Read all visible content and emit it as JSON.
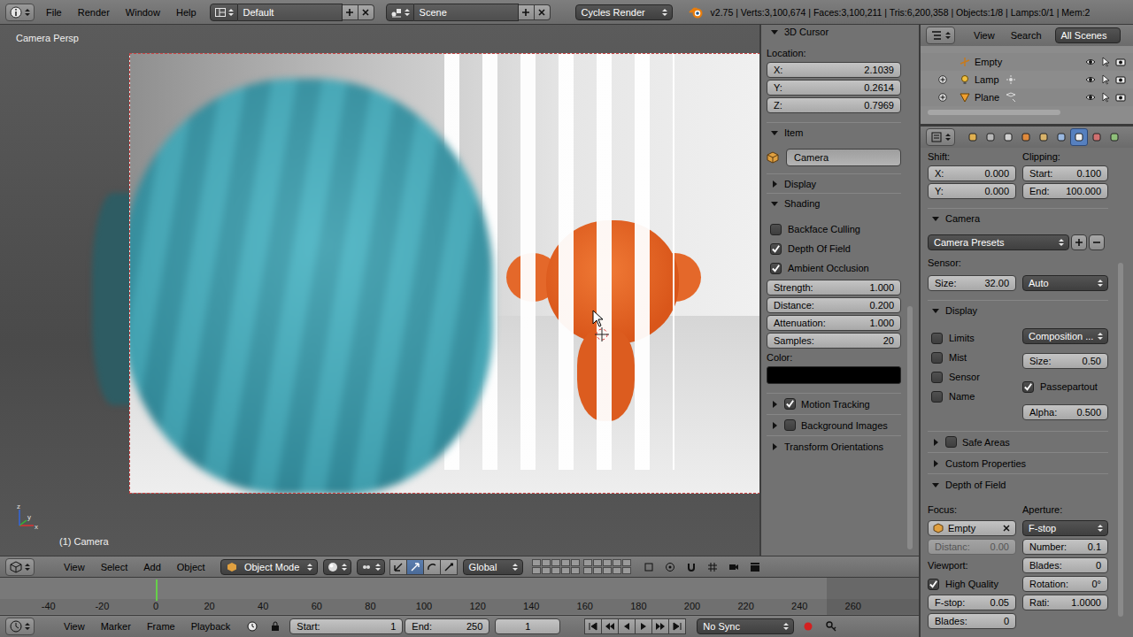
{
  "topbar": {
    "menus": [
      "File",
      "Render",
      "Window",
      "Help"
    ],
    "layout": "Default",
    "scene": "Scene",
    "engine": "Cycles Render",
    "stats": "v2.75 | Verts:3,100,674 | Faces:3,100,211 | Tris:6,200,358 | Objects:1/8 | Lamps:0/1 | Mem:2"
  },
  "viewport": {
    "view_name": "Camera Persp",
    "object_label": "(1) Camera",
    "axes": [
      "x",
      "y",
      "z"
    ]
  },
  "n_panel": {
    "cursor": {
      "title": "3D Cursor",
      "expanded": true,
      "location_label": "Location:",
      "fields": [
        {
          "label": "X:",
          "value": "2.1039"
        },
        {
          "label": "Y:",
          "value": "0.2614"
        },
        {
          "label": "Z:",
          "value": "0.7969"
        }
      ]
    },
    "item": {
      "title": "Item",
      "expanded": true,
      "name": "Camera"
    },
    "display": {
      "title": "Display",
      "expanded": false
    },
    "shading": {
      "title": "Shading",
      "expanded": true,
      "toggles": [
        {
          "label": "Backface Culling",
          "checked": false
        },
        {
          "label": "Depth Of Field",
          "checked": true
        },
        {
          "label": "Ambient Occlusion",
          "checked": true
        }
      ],
      "fields": [
        {
          "label": "Strength:",
          "value": "1.000"
        },
        {
          "label": "Distance:",
          "value": "0.200"
        },
        {
          "label": "Attenuation:",
          "value": "1.000"
        },
        {
          "label": "Samples:",
          "value": "20"
        }
      ],
      "color_label": "Color:",
      "color": "#000000"
    },
    "more_panels": [
      {
        "title": "Motion Tracking",
        "kind": "toggle",
        "checked": true,
        "expanded": false
      },
      {
        "title": "Background Images",
        "kind": "toggle",
        "checked": false,
        "expanded": false
      },
      {
        "title": "Transform Orientations",
        "kind": "plain",
        "checked": false,
        "expanded": false
      }
    ]
  },
  "outliner": {
    "menus": [
      "View",
      "Search"
    ],
    "filter": "All Scenes",
    "rows": [
      {
        "name": "Empty",
        "kind": "empty",
        "expandable": false
      },
      {
        "name": "Lamp",
        "kind": "lamp",
        "expandable": true
      },
      {
        "name": "Plane",
        "kind": "mesh",
        "expandable": true
      }
    ]
  },
  "properties": {
    "tabs": [
      {
        "selected": false
      },
      {
        "selected": false
      },
      {
        "selected": false
      },
      {
        "selected": false
      },
      {
        "selected": false
      },
      {
        "selected": false
      },
      {
        "selected": true
      },
      {
        "selected": false
      },
      {
        "selected": false
      }
    ],
    "lens": {
      "shift_label": "Shift:",
      "shift": [
        {
          "label": "X:",
          "value": "0.000"
        },
        {
          "label": "Y:",
          "value": "0.000"
        }
      ],
      "clipping_label": "Clipping:",
      "clipping": [
        {
          "label": "Start:",
          "value": "0.100"
        },
        {
          "label": "End:",
          "value": "100.000"
        }
      ]
    },
    "camera": {
      "title": "Camera",
      "expanded": true,
      "presets": "Camera Presets",
      "sensor_label": "Sensor:",
      "size": {
        "label": "Size:",
        "value": "32.00"
      },
      "fit": "Auto"
    },
    "display": {
      "title": "Display",
      "expanded": true,
      "toggles": [
        {
          "label": "Limits",
          "checked": false
        },
        {
          "label": "Mist",
          "checked": false
        },
        {
          "label": "Sensor",
          "checked": false
        },
        {
          "label": "Name",
          "checked": false
        }
      ],
      "composition": "Composition ...",
      "size": {
        "label": "Size:",
        "value": "0.50"
      },
      "passepartout": {
        "label": "Passepartout",
        "checked": true
      },
      "alpha": {
        "label": "Alpha:",
        "value": "0.500"
      }
    },
    "more_panels": [
      {
        "title": "Safe Areas",
        "kind": "toggle",
        "checked": false,
        "expanded": false
      },
      {
        "title": "Custom Properties",
        "kind": "plain",
        "checked": false,
        "expanded": false
      }
    ],
    "dof": {
      "title": "Depth of Field",
      "expanded": true,
      "focus_label": "Focus:",
      "focus_object": "Empty",
      "distance": {
        "label": "Distanc:",
        "value": "0.00",
        "disabled": true
      },
      "viewport_label": "Viewport:",
      "high_quality": {
        "label": "High Quality",
        "checked": true
      },
      "viewport_fields": [
        {
          "label": "F-stop:",
          "value": "0.05"
        },
        {
          "label": "Blades:",
          "value": "0"
        }
      ],
      "aperture_label": "Aperture:",
      "aperture_type": "F-stop",
      "aperture_fields": [
        {
          "label": "Number:",
          "value": "0.1"
        },
        {
          "label": "Blades:",
          "value": "0"
        },
        {
          "label": "Rotation:",
          "value": "0°"
        },
        {
          "label": "Rati:",
          "value": "1.0000"
        }
      ]
    }
  },
  "view_header": {
    "menus": [
      "View",
      "Select",
      "Add",
      "Object"
    ],
    "mode": "Object Mode",
    "orientation": "Global"
  },
  "timeline": {
    "ticks": [
      "-40",
      "-20",
      "0",
      "20",
      "40",
      "60",
      "80",
      "100",
      "120",
      "140",
      "160",
      "180",
      "200",
      "220",
      "240",
      "260"
    ],
    "current_frame": 0
  },
  "timeline_header": {
    "menus": [
      "View",
      "Marker",
      "Frame",
      "Playback"
    ],
    "start": {
      "label": "Start:",
      "value": "1"
    },
    "end": {
      "label": "End:",
      "value": "250"
    },
    "current": "1",
    "sync": "No Sync"
  }
}
